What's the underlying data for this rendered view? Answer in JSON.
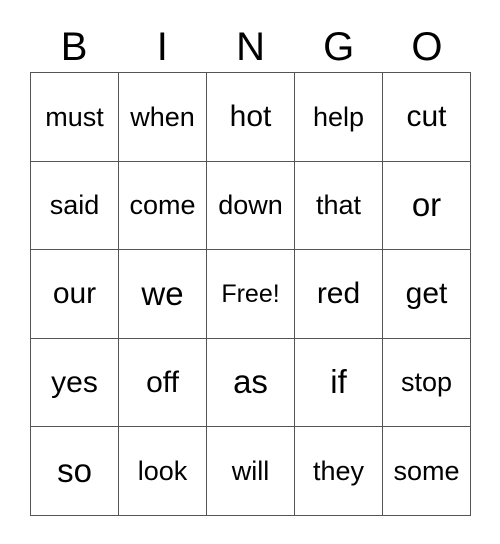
{
  "card": {
    "title": "BINGO",
    "columns": [
      "B",
      "I",
      "N",
      "G",
      "O"
    ],
    "free_space_label": "Free!",
    "border_color": "#555555",
    "text_color": "#000000",
    "background_color": "#ffffff",
    "rows": [
      [
        "must",
        "when",
        "hot",
        "help",
        "cut"
      ],
      [
        "said",
        "come",
        "down",
        "that",
        "or"
      ],
      [
        "our",
        "we",
        "Free!",
        "red",
        "get"
      ],
      [
        "yes",
        "off",
        "as",
        "if",
        "stop"
      ],
      [
        "so",
        "look",
        "will",
        "they",
        "some"
      ]
    ]
  }
}
